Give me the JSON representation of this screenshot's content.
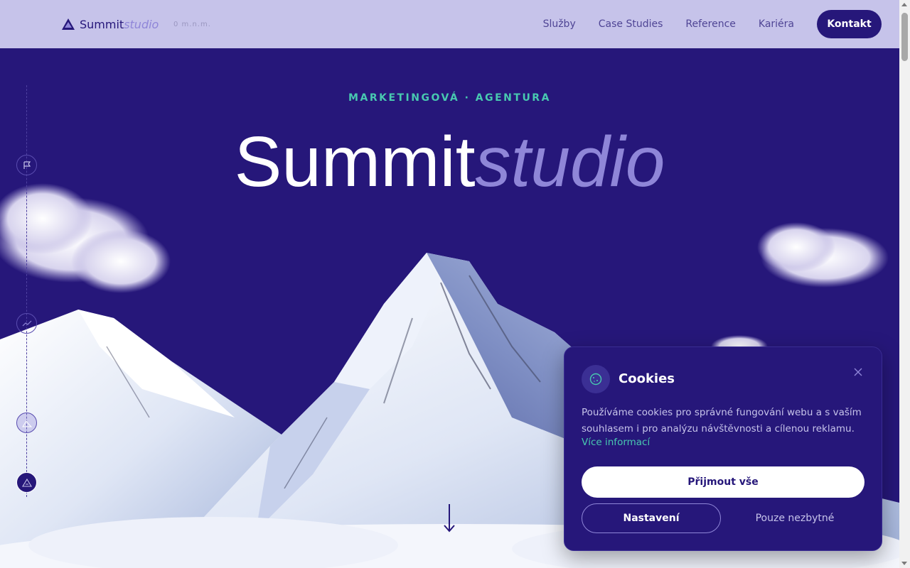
{
  "header": {
    "logo_main": "Summit",
    "logo_accent": "studio",
    "altitude": "0 m.n.m.",
    "nav": [
      "Služby",
      "Case Studies",
      "Reference",
      "Kariéra"
    ],
    "contact_label": "Kontakt"
  },
  "hero": {
    "eyebrow": "MARKETINGOVÁ · AGENTURA",
    "title_main": "Summit",
    "title_accent": "studio"
  },
  "sidebar": {
    "icons": [
      "flag-icon",
      "trend-icon",
      "mountain-icon",
      "summit-icon"
    ]
  },
  "cookie": {
    "title": "Cookies",
    "text": "Používáme cookies pro správné fungování webu a s vaším souhlasem i pro analýzu návštěvnosti a cílenou reklamu.",
    "more_link": "Více informací",
    "accept_label": "Přijmout vše",
    "settings_label": "Nastavení",
    "necessary_label": "Pouze nezbytné"
  },
  "colors": {
    "primary": "#26177a",
    "lavender": "#c6c3ea",
    "accent": "#8f86d8",
    "teal": "#48c9b0"
  }
}
